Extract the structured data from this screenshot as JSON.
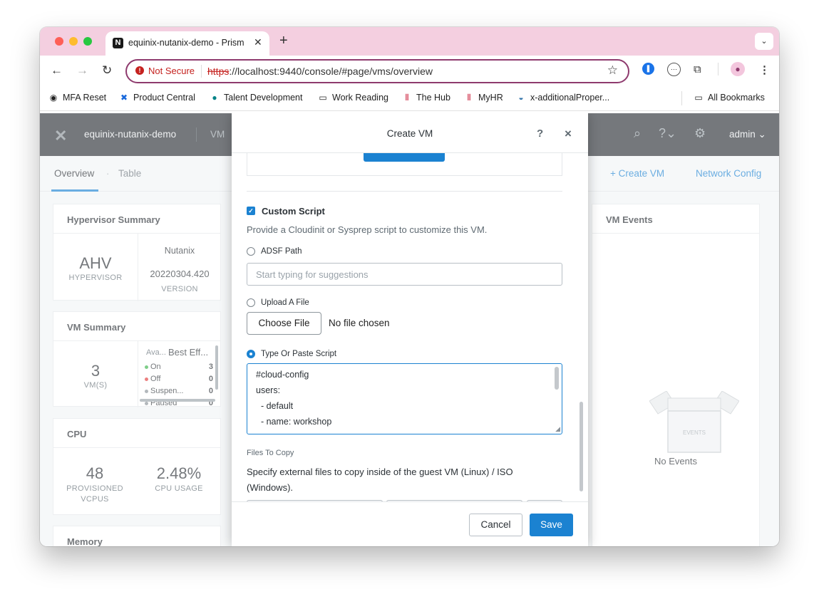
{
  "browser": {
    "tab_title": "equinix-nutanix-demo - Prism",
    "favicon_letter": "N",
    "security_label": "Not Secure",
    "url_scheme": "https",
    "url_rest": "://localhost:9440/console/#page/vms/overview",
    "bookmarks": [
      {
        "label": "MFA Reset",
        "icon": "globe-icon"
      },
      {
        "label": "Product Central",
        "icon": "confluence-icon"
      },
      {
        "label": "Talent Development",
        "icon": "sharepoint-icon"
      },
      {
        "label": "Work Reading",
        "icon": "folder-icon"
      },
      {
        "label": "The Hub",
        "icon": "hub-icon"
      },
      {
        "label": "MyHR",
        "icon": "myhr-icon"
      },
      {
        "label": "x-additionalProper...",
        "icon": "python-icon"
      },
      {
        "label": "All Bookmarks",
        "icon": "folder-icon"
      }
    ]
  },
  "app": {
    "cluster_name": "equinix-nutanix-demo",
    "nav_menu": "VM",
    "user": "admin",
    "tabs": {
      "overview": "Overview",
      "table": "Table"
    },
    "actions": {
      "create_vm": "+ Create VM",
      "network_config": "Network Config"
    },
    "hypervisor_summary": {
      "title": "Hypervisor Summary",
      "hypervisor": "AHV",
      "hypervisor_label": "HYPERVISOR",
      "vendor": "Nutanix",
      "version": "20220304.420",
      "version_label": "VERSION"
    },
    "vm_summary": {
      "title": "VM Summary",
      "count": "3",
      "count_label": "VM(S)",
      "avail_label": "Ava...",
      "best_effort": "Best Eff...",
      "statuses": [
        {
          "label": "On",
          "count": "3",
          "color": "#3bb44a"
        },
        {
          "label": "Off",
          "count": "0",
          "color": "#e03b3b"
        },
        {
          "label": "Suspen...",
          "count": "0",
          "color": "#8a9299"
        },
        {
          "label": "Paused",
          "count": "0",
          "color": "#8a9299"
        }
      ]
    },
    "cpu": {
      "title": "CPU",
      "vcpus": "48",
      "vcpus_label_1": "PROVISIONED",
      "vcpus_label_2": "VCPUS",
      "usage": "2.48%",
      "usage_label": "CPU USAGE"
    },
    "memory": {
      "title": "Memory"
    },
    "vm_events": {
      "title": "VM Events",
      "empty_label": "No Events",
      "box_label": "EVENTS"
    }
  },
  "modal": {
    "title": "Create VM",
    "help": "?",
    "close": "×",
    "custom_script_label": "Custom Script",
    "custom_script_desc": "Provide a Cloudinit or Sysprep script to customize this VM.",
    "adsf_label": "ADSF Path",
    "adsf_placeholder": "Start typing for suggestions",
    "upload_label": "Upload A File",
    "choose_file": "Choose File",
    "no_file": "No file chosen",
    "paste_label": "Type Or Paste Script",
    "script_lines": [
      "#cloud-config",
      "users:",
      "  - default",
      "  - name: workshop"
    ],
    "files_to_copy_label": "Files To Copy",
    "files_to_copy_desc_1": "Specify external files to copy inside of the guest VM (Linux) / ISO",
    "files_to_copy_desc_2": "(Windows).",
    "cancel": "Cancel",
    "save": "Save"
  }
}
